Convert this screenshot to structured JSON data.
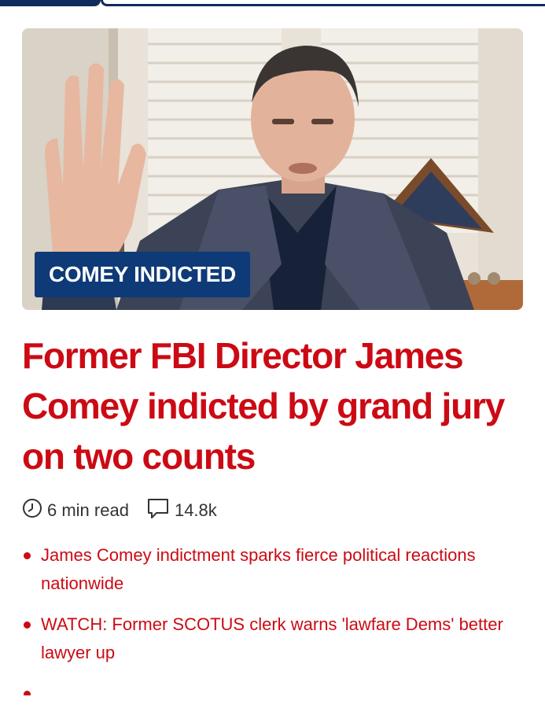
{
  "badge": {
    "label": "COMEY INDICTED"
  },
  "article": {
    "headline": "Former FBI Director James Comey indicted by grand jury on two counts",
    "read_time": "6 min read",
    "comment_count": "14.8k"
  },
  "related": [
    {
      "text": "James Comey indictment sparks fierce political reactions nationwide"
    },
    {
      "text": "WATCH: Former SCOTUS clerk warns 'lawfare Dems' better lawyer up"
    },
    {
      "text": ""
    }
  ],
  "colors": {
    "headline": "#cc0a14",
    "badge_bg": "#0e3a78",
    "top_bar": "#0f2c5c"
  },
  "icons": {
    "read_time": "clock-icon",
    "comments": "comment-bubble-icon"
  }
}
